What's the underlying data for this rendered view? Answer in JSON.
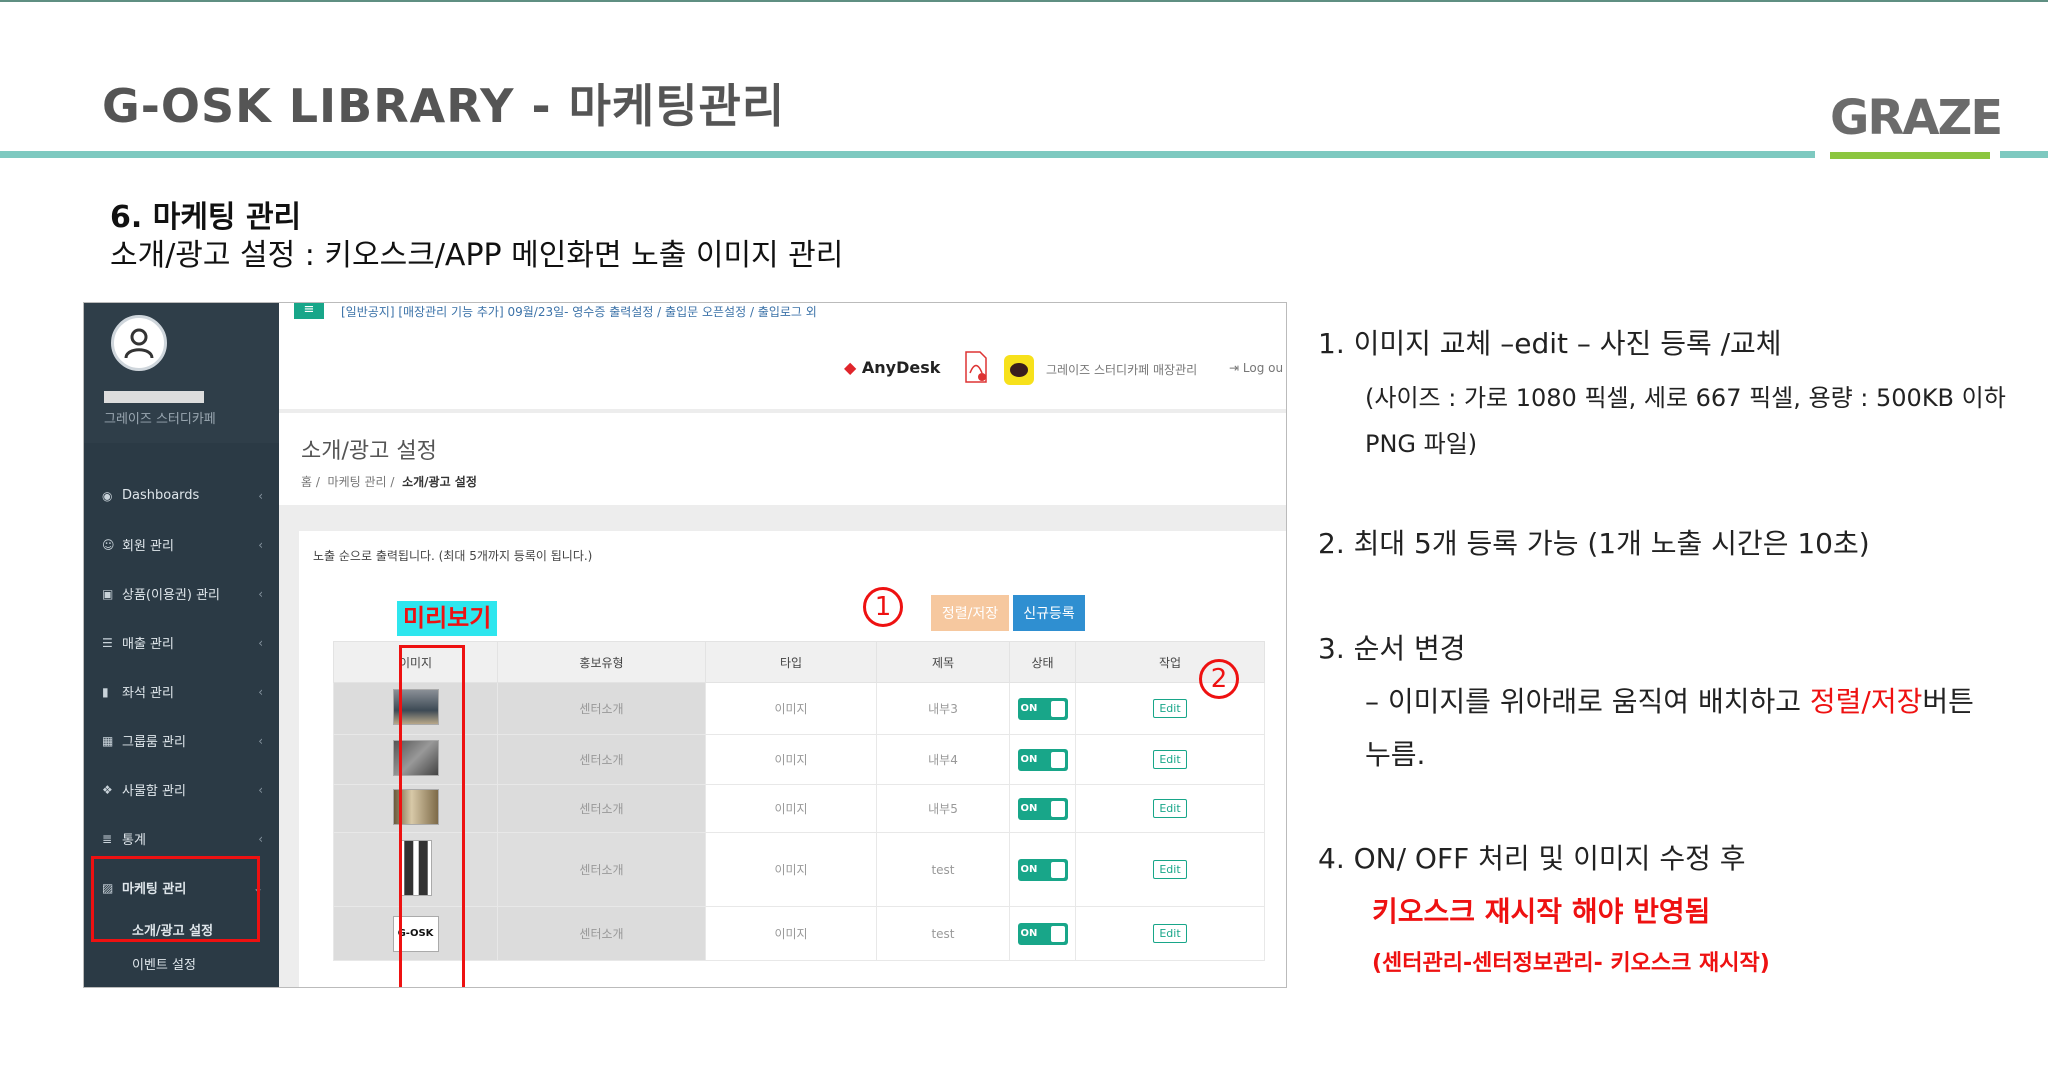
{
  "header": {
    "title": "G-OSK LIBRARY - 마케팅관리",
    "logo_text": "GRAZE",
    "accent_color": "#7ec9c0",
    "logo_bar_color": "#8cc63f"
  },
  "section": {
    "heading": "6. 마케팅 관리",
    "subheading": "소개/광고 설정 : 키오스크/APP 메인화면 노출 이미지 관리"
  },
  "screenshot": {
    "sidebar": {
      "org_name": "그레이즈 스터디카페",
      "items": [
        {
          "label": "Dashboards",
          "icon": "dashboard-icon"
        },
        {
          "label": "회원 관리",
          "icon": "user-circle-icon"
        },
        {
          "label": "상품(이용권) 관리",
          "icon": "gift-icon"
        },
        {
          "label": "매출 관리",
          "icon": "list-icon"
        },
        {
          "label": "좌석 관리",
          "icon": "book-icon"
        },
        {
          "label": "그룹룸 관리",
          "icon": "calendar-icon"
        },
        {
          "label": "사물함 관리",
          "icon": "cubes-icon"
        },
        {
          "label": "통계",
          "icon": "database-icon"
        },
        {
          "label": "마케팅 관리",
          "icon": "image-icon"
        }
      ],
      "sub_items": [
        "소개/광고 설정",
        "이벤트 설정"
      ]
    },
    "topbar": {
      "notice": "[일반공지] [매장관리 기능 추가] 09월/23일- 영수증 출력설정 / 출입문 오픈설정 / 출입로그 외",
      "anydesk": "AnyDesk",
      "center_name": "그레이즈 스터디카페 매장관리",
      "logout": "Log ou"
    },
    "page": {
      "title": "소개/광고 설정",
      "breadcrumb": [
        "홈",
        "마케팅 관리",
        "소개/광고 설정"
      ]
    },
    "panel": {
      "note": "노출 순으로 출력됩니다. (최대 5개까지 등록이 됩니다.)",
      "preview_label": "미리보기",
      "sort_button": "정렬/저장",
      "new_button": "신규등록",
      "circle1": "1",
      "circle2": "2"
    },
    "table": {
      "headers": [
        "이미지",
        "홍보유형",
        "타입",
        "제목",
        "상태",
        "작업"
      ],
      "rows": [
        {
          "type": "센터소개",
          "kind": "이미지",
          "title": "내부3",
          "status": "ON",
          "action": "Edit"
        },
        {
          "type": "센터소개",
          "kind": "이미지",
          "title": "내부4",
          "status": "ON",
          "action": "Edit"
        },
        {
          "type": "센터소개",
          "kind": "이미지",
          "title": "내부5",
          "status": "ON",
          "action": "Edit"
        },
        {
          "type": "센터소개",
          "kind": "이미지",
          "title": "test",
          "status": "ON",
          "action": "Edit"
        },
        {
          "type": "센터소개",
          "kind": "이미지",
          "title": "test",
          "status": "ON",
          "action": "Edit"
        }
      ],
      "last_thumb_text": "G-OSK"
    }
  },
  "instructions": {
    "item1_title": "1.   이미지 교체 –edit – 사진 등록 /교체",
    "item1_line2": "(사이즈 : 가로 1080 픽셀, 세로 667 픽셀, 용량 : 500KB 이하",
    "item1_line3": "PNG 파일)",
    "item2": "2.   최대 5개 등록 가능 (1개 노출 시간은 10초)",
    "item3_title": "3.   순서 변경",
    "item3_line2_a": "– 이미지를 위아래로 움직여 배치하고 ",
    "item3_line2_red": "정렬/저장",
    "item3_line2_b": "버튼",
    "item3_line3": "누름.",
    "item4_title": "4.   ON/ OFF  처리 및 이미지 수정 후",
    "item4_red": "키오스크 재시작 해야 반영됨",
    "item4_red_small": "(센터관리-센터정보관리- 키오스크 재시작)"
  }
}
